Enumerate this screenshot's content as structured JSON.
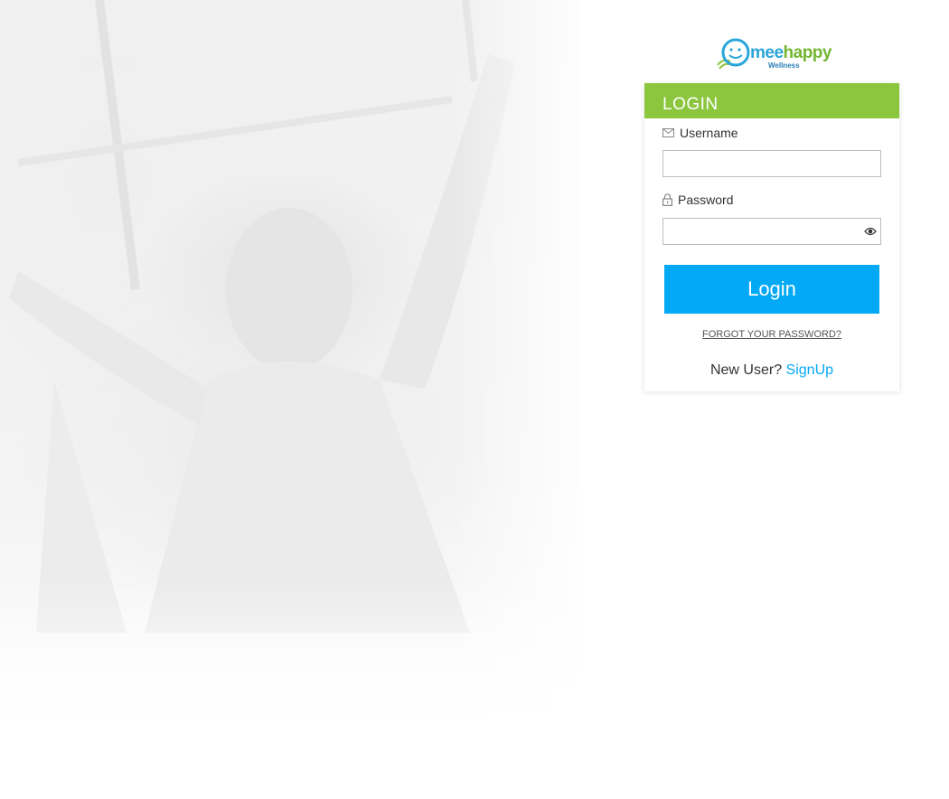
{
  "brand": {
    "logo_primary": "mee",
    "logo_secondary": "happy",
    "logo_sub": "Wellness"
  },
  "login_card": {
    "title": "LOGIN",
    "username_label": "Username",
    "username_value": "",
    "password_label": "Password",
    "password_value": "",
    "login_button": "Login",
    "forgot_link": "FORGOT YOUR PASSWORD?",
    "new_user_text": "New User?",
    "signup_link": "SignUp"
  },
  "colors": {
    "header_green": "#8cc63f",
    "button_blue": "#03a9f4",
    "link_blue": "#03a9f4"
  },
  "icons": {
    "username": "envelope-icon",
    "password": "lock-icon",
    "toggle_password": "eye-icon"
  }
}
